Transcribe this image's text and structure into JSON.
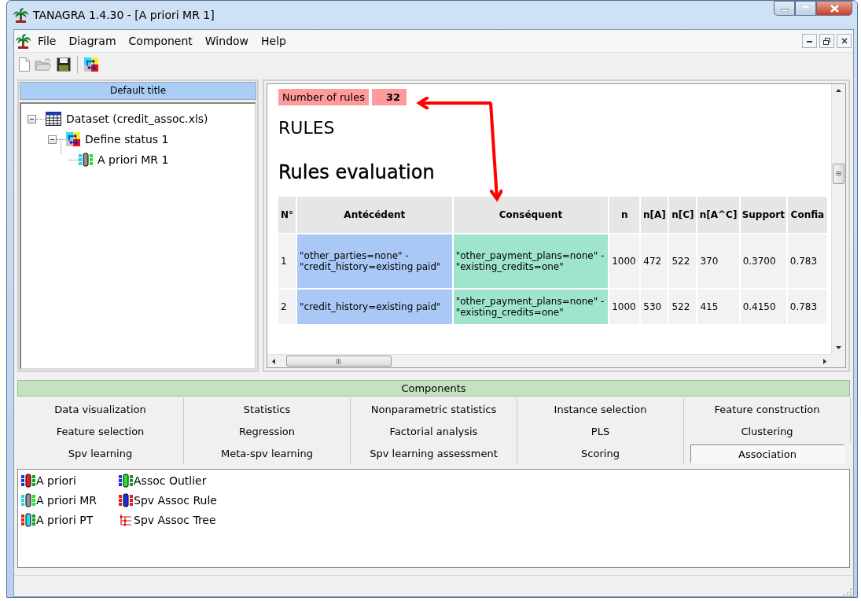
{
  "window": {
    "title": "TANAGRA 1.4.30 - [A priori MR 1]"
  },
  "menu": [
    "File",
    "Diagram",
    "Component",
    "Window",
    "Help"
  ],
  "diagram": {
    "title": "Default title",
    "tree": [
      {
        "label": "Dataset (credit_assoc.xls)",
        "kind": "dataset",
        "expanded": true,
        "children": [
          {
            "label": "Define status 1",
            "kind": "status",
            "expanded": true,
            "children": [
              {
                "label": "A priori MR 1",
                "kind": "component"
              }
            ]
          }
        ]
      }
    ]
  },
  "report": {
    "summary": {
      "label": "Number of rules",
      "value": "32"
    },
    "heading": "RULES",
    "subheading": "Rules evaluation",
    "table": {
      "columns": [
        {
          "label": "N°",
          "kind": "index"
        },
        {
          "label": "Antécédent",
          "kind": "antecedent"
        },
        {
          "label": "Conséquent",
          "kind": "consequent"
        },
        {
          "label": "n",
          "kind": "number"
        },
        {
          "label": "n[A]",
          "kind": "number"
        },
        {
          "label": "n[C]",
          "kind": "number"
        },
        {
          "label": "n[A^C]",
          "kind": "number"
        },
        {
          "label": "Support",
          "kind": "number"
        },
        {
          "label": "Confia",
          "kind": "number"
        }
      ],
      "rows": [
        [
          "1",
          "\"other_parties=none\" - \"credit_history=existing paid\"",
          "\"other_payment_plans=none\" - \"existing_credits=one\"",
          "1000",
          "472",
          "522",
          "370",
          "0.3700",
          "0.783"
        ],
        [
          "2",
          "\"credit_history=existing paid\"",
          "\"other_payment_plans=none\" - \"existing_credits=one\"",
          "1000",
          "530",
          "522",
          "415",
          "0.4150",
          "0.783"
        ]
      ]
    }
  },
  "components": {
    "title": "Components",
    "tabs": [
      {
        "label": "Data visualization",
        "selected": false
      },
      {
        "label": "Statistics",
        "selected": false
      },
      {
        "label": "Nonparametric statistics",
        "selected": false
      },
      {
        "label": "Instance selection",
        "selected": false
      },
      {
        "label": "Feature construction",
        "selected": false
      },
      {
        "label": "Feature selection",
        "selected": false
      },
      {
        "label": "Regression",
        "selected": false
      },
      {
        "label": "Factorial analysis",
        "selected": false
      },
      {
        "label": "PLS",
        "selected": false
      },
      {
        "label": "Clustering",
        "selected": false
      },
      {
        "label": "Spv learning",
        "selected": false
      },
      {
        "label": "Meta-spv learning",
        "selected": false
      },
      {
        "label": "Spv learning assessment",
        "selected": false
      },
      {
        "label": "Scoring",
        "selected": false
      },
      {
        "label": "Association",
        "selected": true
      }
    ],
    "items": [
      {
        "label": "A priori",
        "kind": "apriori"
      },
      {
        "label": "A priori MR",
        "kind": "apriori_mr"
      },
      {
        "label": "A priori PT",
        "kind": "apriori_pt"
      },
      {
        "label": "Assoc Outlier",
        "kind": "outlier"
      },
      {
        "label": "Spv Assoc Rule",
        "kind": "spv_rule"
      },
      {
        "label": "Spv Assoc Tree",
        "kind": "tree"
      }
    ]
  }
}
